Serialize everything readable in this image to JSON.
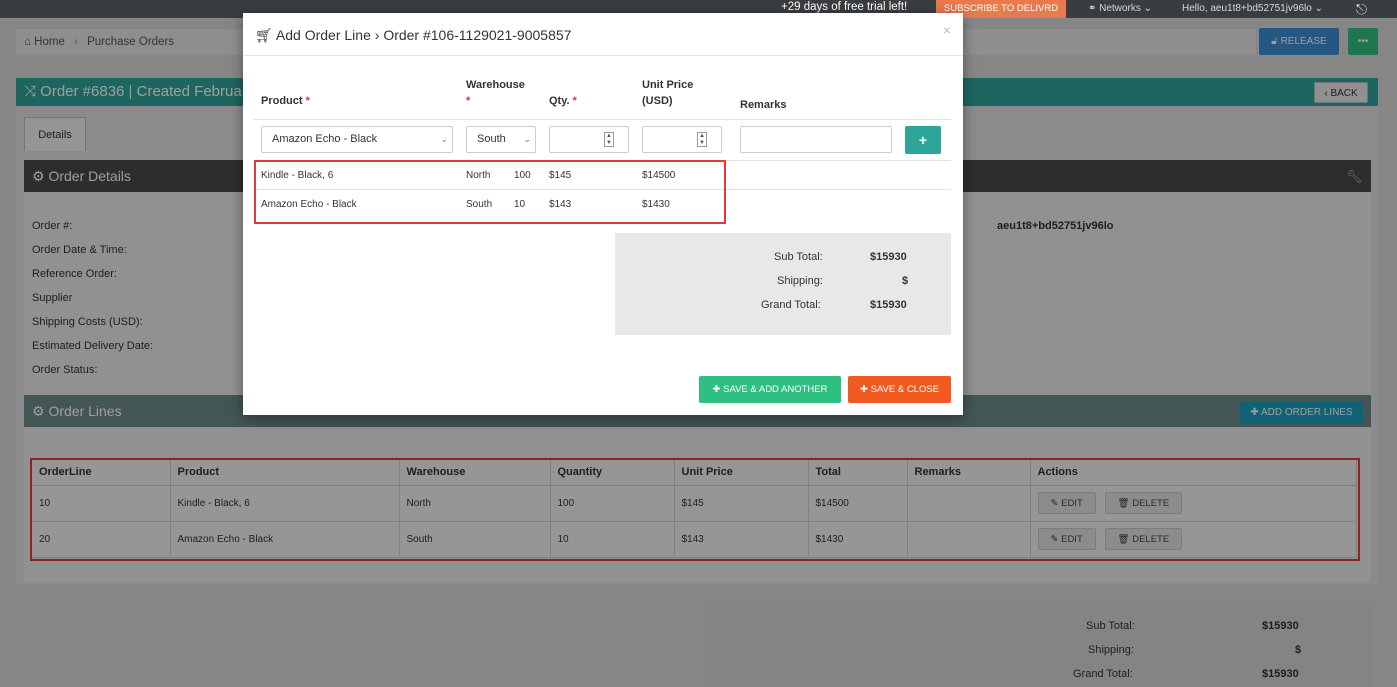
{
  "topbar": {
    "trial_text": "+29 days of free trial left!",
    "subscribe_label": "SUBSCRIBE TO DELIVRD",
    "networks_label": "Networks",
    "hello_text": "Hello, aeu1t8+bd52751jv96lo"
  },
  "breadcrumb": {
    "home": "Home",
    "current": "Purchase Orders"
  },
  "actions": {
    "release_label": "RELEASE",
    "back_label": "BACK"
  },
  "order": {
    "header": "Order #6836 | Created Februa"
  },
  "tabs": {
    "details": "Details"
  },
  "order_details": {
    "title": "Order Details",
    "labels": [
      "Order #:",
      "Order Date & Time:",
      "Reference Order:",
      "Supplier",
      "Shipping Costs (USD):",
      "Estimated Delivery Date:",
      "Order Status:"
    ],
    "user_value": "aeu1t8+bd52751jv96lo"
  },
  "order_lines": {
    "title": "Order Lines",
    "add_label": "ADD ORDER LINES",
    "columns": [
      "OrderLine",
      "Product",
      "Warehouse",
      "Quantity",
      "Unit Price",
      "Total",
      "Remarks",
      "Actions"
    ],
    "rows": [
      {
        "line": "10",
        "product": "Kindle - Black, 6",
        "warehouse": "North",
        "quantity": "100",
        "unit_price": "$145",
        "total": "$14500",
        "remarks": ""
      },
      {
        "line": "20",
        "product": "Amazon Echo - Black",
        "warehouse": "South",
        "quantity": "10",
        "unit_price": "$143",
        "total": "$1430",
        "remarks": ""
      }
    ],
    "edit_label": "EDIT",
    "delete_label": "DELETE"
  },
  "page_totals": {
    "sub_total_label": "Sub Total:",
    "sub_total": "$15930",
    "shipping_label": "Shipping:",
    "shipping": "$",
    "grand_total_label": "Grand Total:",
    "grand_total": "$15930"
  },
  "modal": {
    "title_main": "Add Order Line",
    "title_sep": "›",
    "title_order": "Order #106-1129021-9005857",
    "close": "×",
    "headers": {
      "product": "Product",
      "warehouse": "Warehouse",
      "qty": "Qty.",
      "unit_price_1": "Unit Price",
      "unit_price_2": "(USD)",
      "remarks": "Remarks",
      "required_mark": "*"
    },
    "form": {
      "product": "Amazon Echo - Black",
      "warehouse": "South",
      "add_symbol": "+"
    },
    "lines": [
      {
        "product": "Kindle - Black, 6",
        "warehouse": "North",
        "qty": "100",
        "unit_price": "$145",
        "total": "$14500"
      },
      {
        "product": "Amazon Echo - Black",
        "warehouse": "South",
        "qty": "10",
        "unit_price": "$143",
        "total": "$1430"
      }
    ],
    "totals": {
      "sub_total_label": "Sub Total:",
      "sub_total": "$15930",
      "shipping_label": "Shipping:",
      "shipping": "$",
      "grand_total_label": "Grand Total:",
      "grand_total": "$15930"
    },
    "save_add_label": "SAVE & ADD ANOTHER",
    "save_close_label": "SAVE & CLOSE"
  }
}
